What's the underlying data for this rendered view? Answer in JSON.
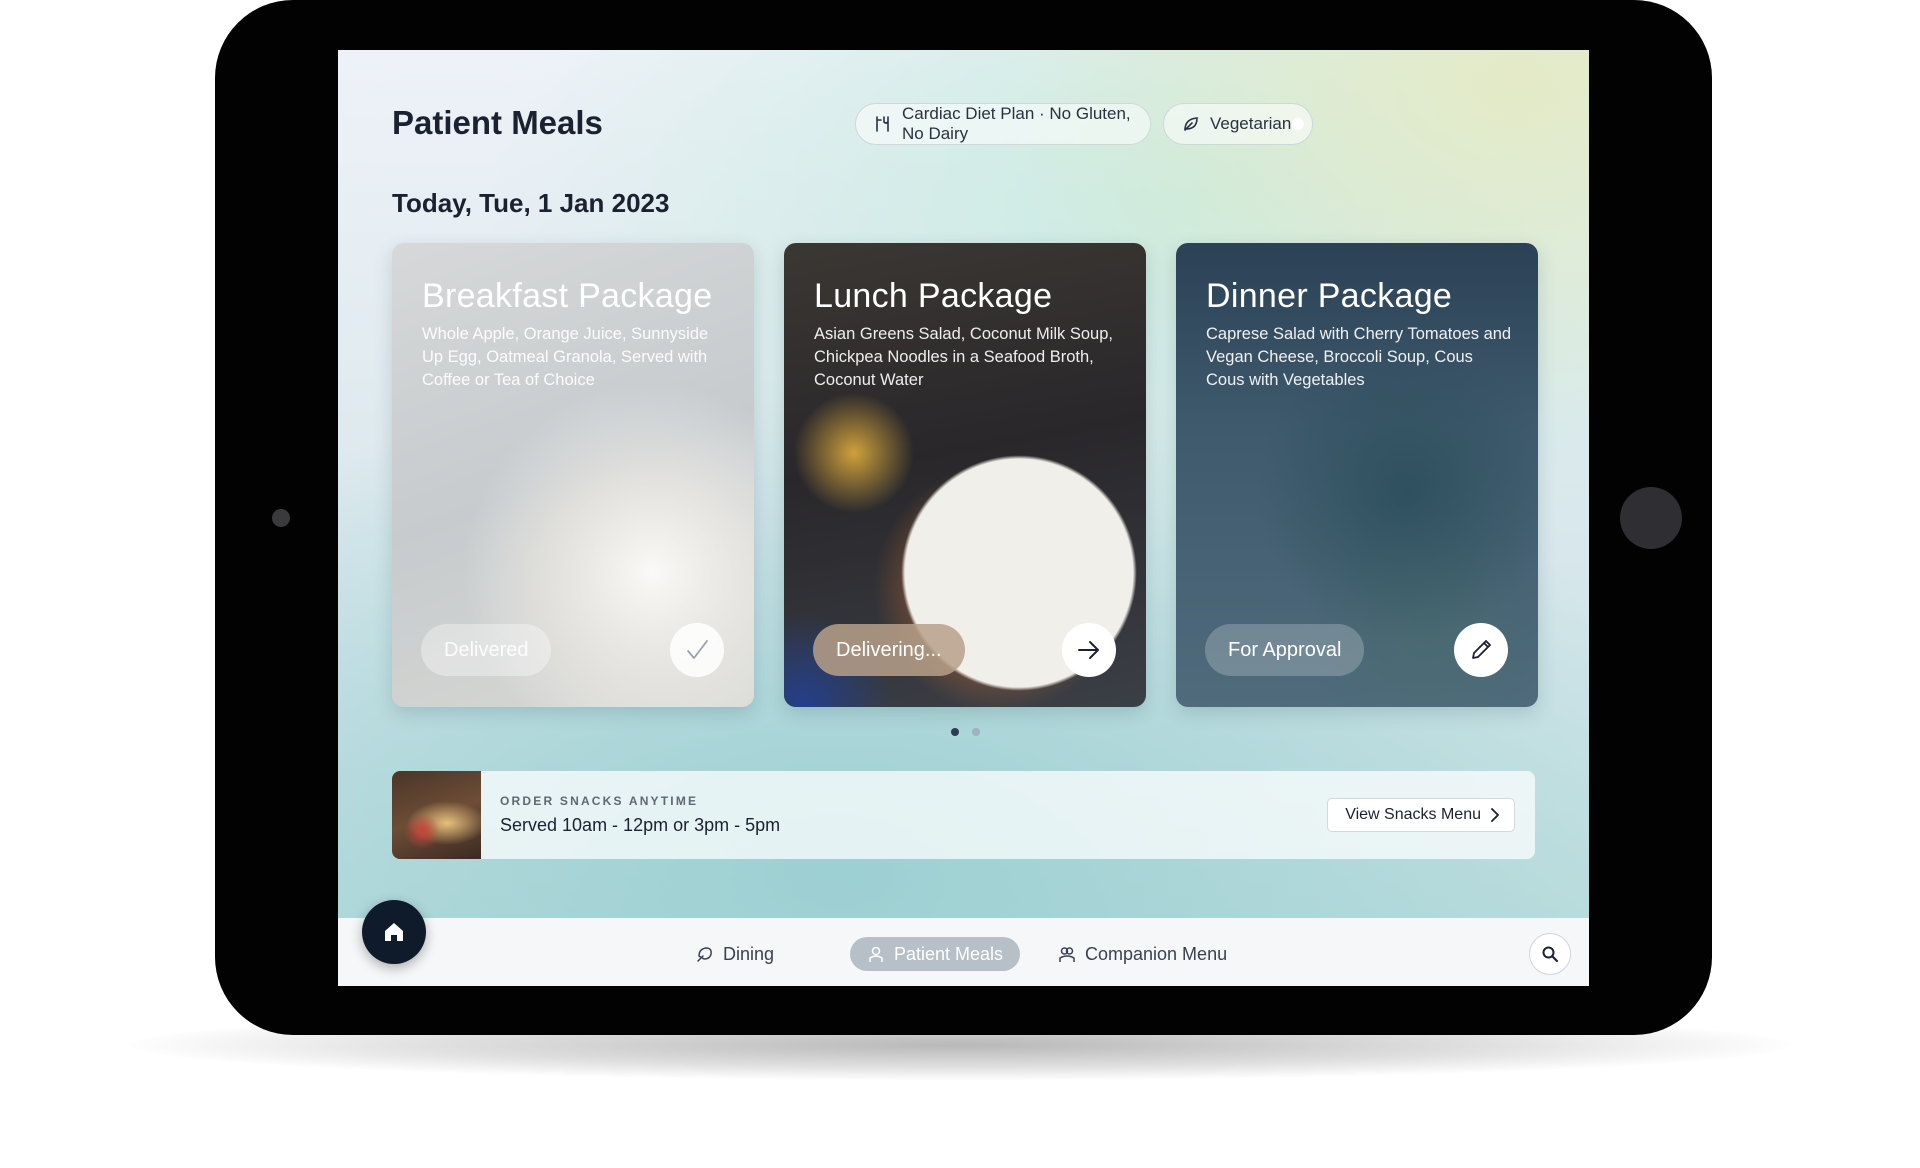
{
  "header": {
    "title": "Patient Meals",
    "diet_plan": "Cardiac Diet Plan · No Gluten, No Dairy",
    "diet_icon": "diet-plan-icon",
    "vegetarian_label": "Vegetarian",
    "vegetarian_on": true,
    "vegetarian_icon": "leaf-icon"
  },
  "date_heading": "Today, Tue, 1 Jan 2023",
  "meals": [
    {
      "title": "Breakfast Package",
      "description": "Whole Apple, Orange Juice, Sunnyside Up Egg, Oatmeal Granola, Served with Coffee or Tea of Choice",
      "status": "Delivered",
      "action_icon": "check-icon"
    },
    {
      "title": "Lunch Package",
      "description": "Asian Greens Salad, Coconut Milk Soup, Chickpea Noodles in a Seafood Broth, Coconut Water",
      "status": "Delivering...",
      "action_icon": "arrow-right-icon"
    },
    {
      "title": "Dinner Package",
      "description": "Caprese Salad with Cherry Tomatoes and Vegan Cheese, Broccoli Soup, Cous Cous with Vegetables",
      "status": "For Approval",
      "action_icon": "pencil-icon"
    }
  ],
  "pagination": {
    "pages": 2,
    "current": 1
  },
  "snacks": {
    "kicker": "ORDER SNACKS ANYTIME",
    "hours": "Served 10am - 12pm or 3pm - 5pm",
    "button_label": "View Snacks Menu"
  },
  "bottom_nav": {
    "items": [
      {
        "label": "Dining",
        "icon": "dining-icon"
      },
      {
        "label": "Patient Meals",
        "icon": "patient-icon",
        "active": true
      },
      {
        "label": "Companion Menu",
        "icon": "companion-icon"
      }
    ]
  },
  "colors": {
    "text_primary": "#1b2130",
    "home_button": "#0f1b2a",
    "nav_active": "#b7c0c7"
  }
}
